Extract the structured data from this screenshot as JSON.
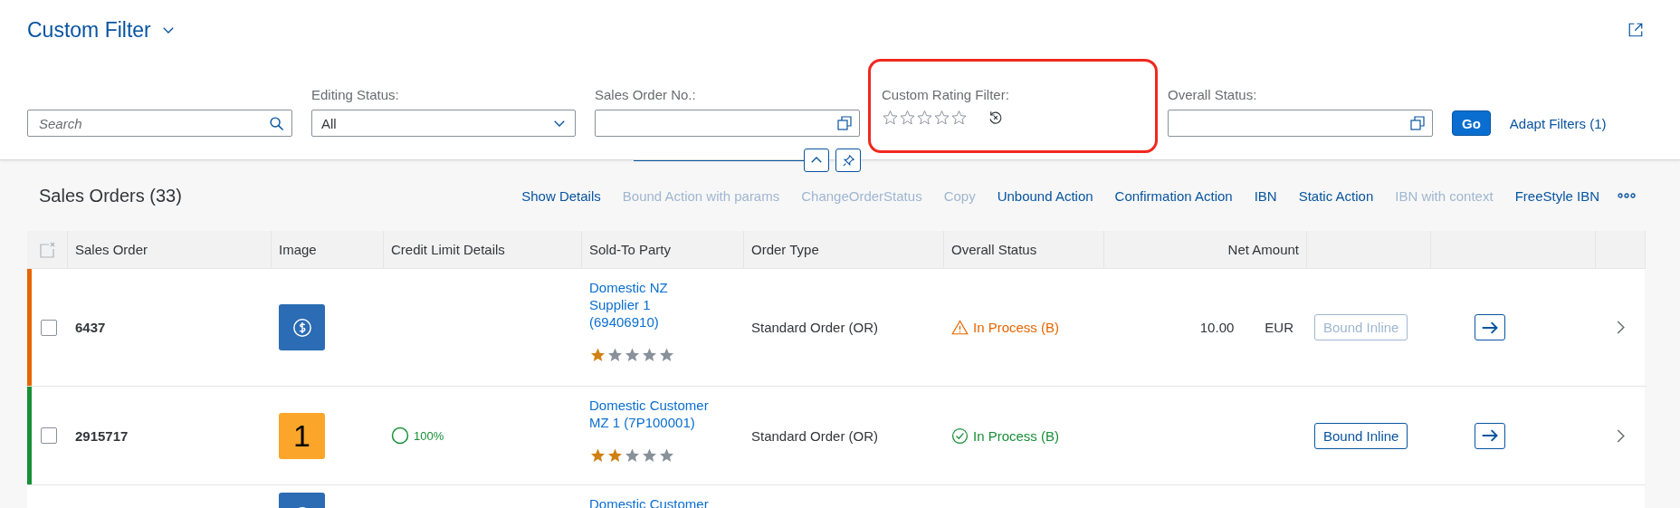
{
  "title": "Custom Filter",
  "filters": [
    {
      "kind": "search",
      "placeholder": "Search"
    },
    {
      "kind": "select",
      "label": "Editing Status:",
      "value": "All"
    },
    {
      "kind": "valuehelp",
      "label": "Sales Order No.:"
    },
    {
      "kind": "rating",
      "label": "Custom Rating Filter:",
      "stars": 0,
      "highlighted": true
    },
    {
      "kind": "valuehelp",
      "label": "Overall Status:"
    }
  ],
  "go_button": "Go",
  "adapt_filters": "Adapt Filters (1)",
  "table": {
    "title": "Sales Orders (33)",
    "actions": [
      {
        "label": "Show Details",
        "disabled": false
      },
      {
        "label": "Bound Action with params",
        "disabled": true
      },
      {
        "label": "ChangeOrderStatus",
        "disabled": true
      },
      {
        "label": "Copy",
        "disabled": true
      },
      {
        "label": "Unbound Action",
        "disabled": false
      },
      {
        "label": "Confirmation Action",
        "disabled": false
      },
      {
        "label": "IBN",
        "disabled": false
      },
      {
        "label": "Static Action",
        "disabled": false
      },
      {
        "label": "IBN with context",
        "disabled": true
      },
      {
        "label": "FreeStyle IBN",
        "disabled": false
      }
    ],
    "columns": [
      "Sales Order",
      "Image",
      "Credit Limit Details",
      "Sold-To Party",
      "Order Type",
      "Overall Status",
      "Net Amount"
    ],
    "rows": [
      {
        "color": "#e76500",
        "checked": false,
        "sales_order": "6437",
        "image": {
          "kind": "icon"
        },
        "sold_to": "Domestic NZ Supplier 1 (69406910)",
        "stars": 1,
        "order_type": "Standard Order (OR)",
        "status": {
          "kind": "warning",
          "text": "In Process (B)"
        },
        "amount": "10.00",
        "currency": "EUR",
        "bound_inline": {
          "label": "Bound Inline",
          "disabled": true
        }
      },
      {
        "color": "#188f36",
        "checked": false,
        "sales_order": "2915717",
        "image": {
          "kind": "number",
          "text": "1"
        },
        "credit": "100%",
        "sold_to": "Domestic Customer MZ 1 (7P100001)",
        "stars": 2,
        "order_type": "Standard Order (OR)",
        "status": {
          "kind": "success",
          "text": "In Process (B)"
        },
        "bound_inline": {
          "label": "Bound Inline",
          "disabled": false
        }
      },
      {
        "sold_to": "Domestic Customer",
        "image": {
          "kind": "icon"
        }
      }
    ]
  }
}
